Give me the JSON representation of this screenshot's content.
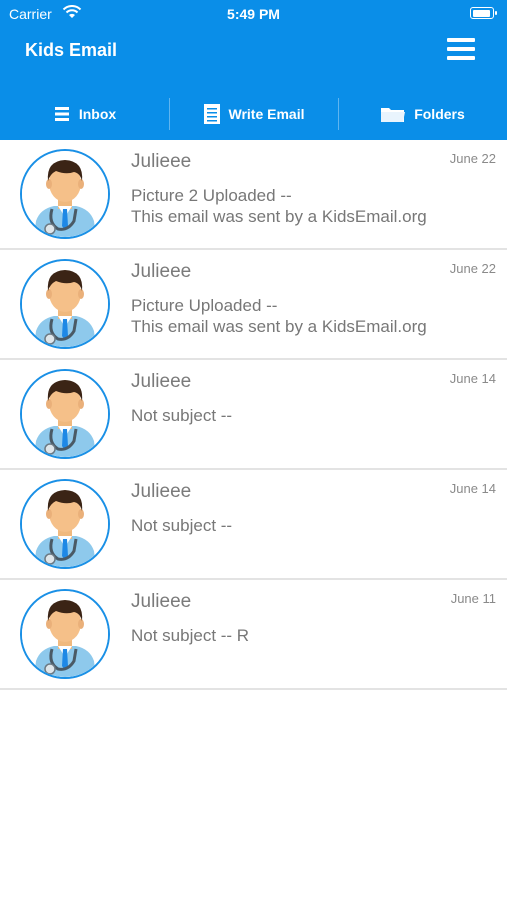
{
  "status_bar": {
    "carrier": "Carrier",
    "time": "5:49 PM"
  },
  "header": {
    "title": "Kids Email"
  },
  "tabs": [
    {
      "label": "Inbox",
      "icon": "list-icon"
    },
    {
      "label": "Write Email",
      "icon": "document-icon"
    },
    {
      "label": "Folders",
      "icon": "folder-icon"
    }
  ],
  "emails": [
    {
      "sender": "Julieee",
      "date": "June 22",
      "subject_line1": "Picture 2 Uploaded --",
      "subject_line2": "This email was sent by a KidsEmail.org"
    },
    {
      "sender": "Julieee",
      "date": "June 22",
      "subject_line1": "Picture Uploaded --",
      "subject_line2": "This email was sent by a KidsEmail.org"
    },
    {
      "sender": "Julieee",
      "date": "June 14",
      "subject_line1": "Not subject --",
      "subject_line2": ""
    },
    {
      "sender": "Julieee",
      "date": "June 14",
      "subject_line1": "Not subject --",
      "subject_line2": ""
    },
    {
      "sender": "Julieee",
      "date": "June 11",
      "subject_line1": "Not subject -- R",
      "subject_line2": ""
    }
  ],
  "colors": {
    "header_bg": "#0a8ee8",
    "avatar_border": "#1a90e6",
    "divider": "#e3e3e3"
  }
}
